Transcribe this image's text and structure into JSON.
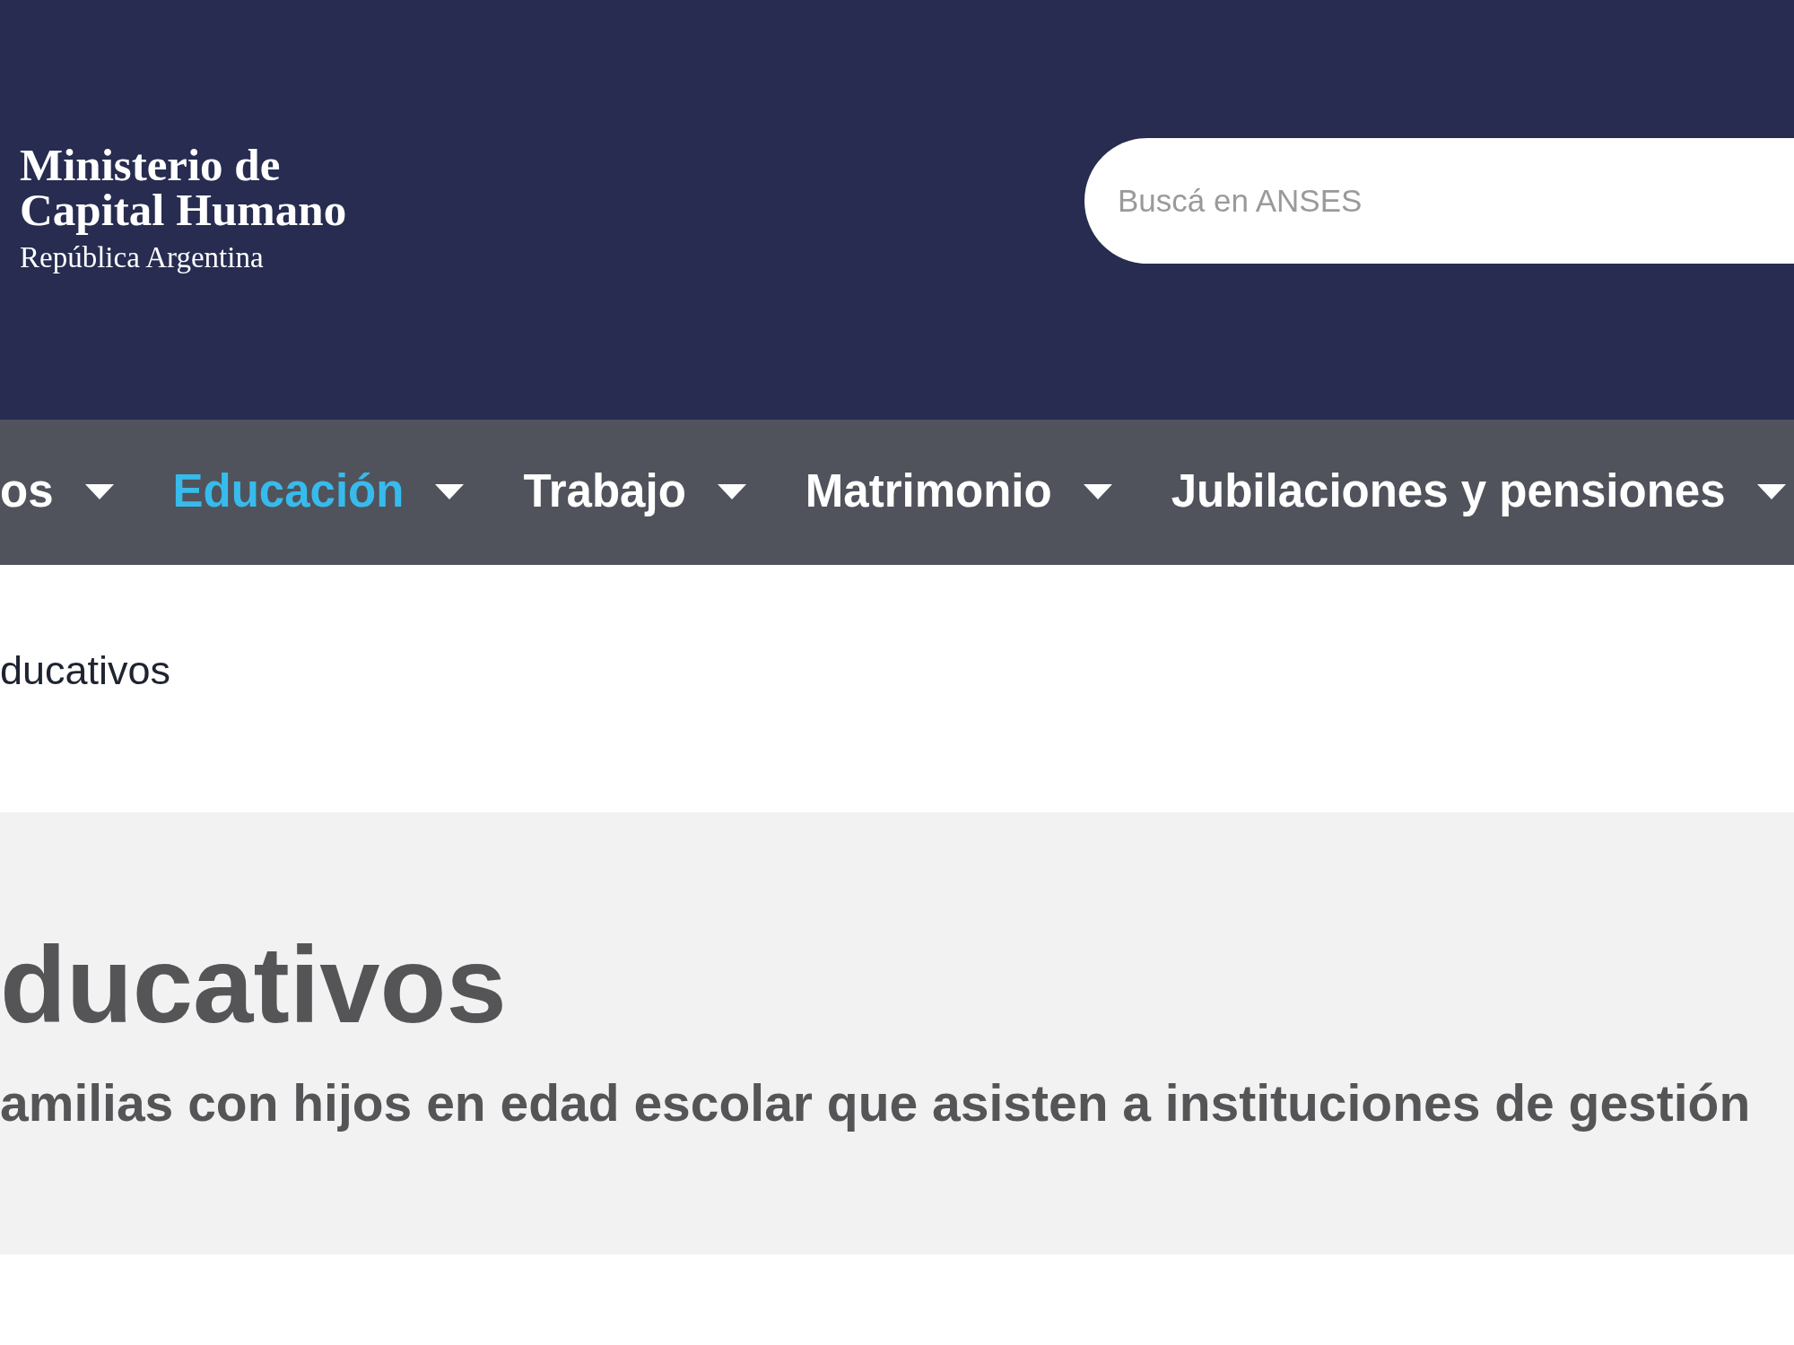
{
  "header": {
    "logo": {
      "title_lines": [
        "Ministerio de",
        "Capital Humano"
      ],
      "subtitle": "República Argentina"
    },
    "search": {
      "placeholder": "Buscá en ANSES"
    }
  },
  "nav": {
    "items": [
      {
        "label": "os",
        "selected": false
      },
      {
        "label": "Educación",
        "selected": true
      },
      {
        "label": "Trabajo",
        "selected": false
      },
      {
        "label": "Matrimonio",
        "selected": false
      },
      {
        "label": "Jubilaciones y pensiones",
        "selected": false
      }
    ]
  },
  "breadcrumb": {
    "current": "ducativos"
  },
  "hero": {
    "title": "ducativos",
    "subtitle": "amilias con hijos en edad escolar que asisten a instituciones de gestión"
  }
}
